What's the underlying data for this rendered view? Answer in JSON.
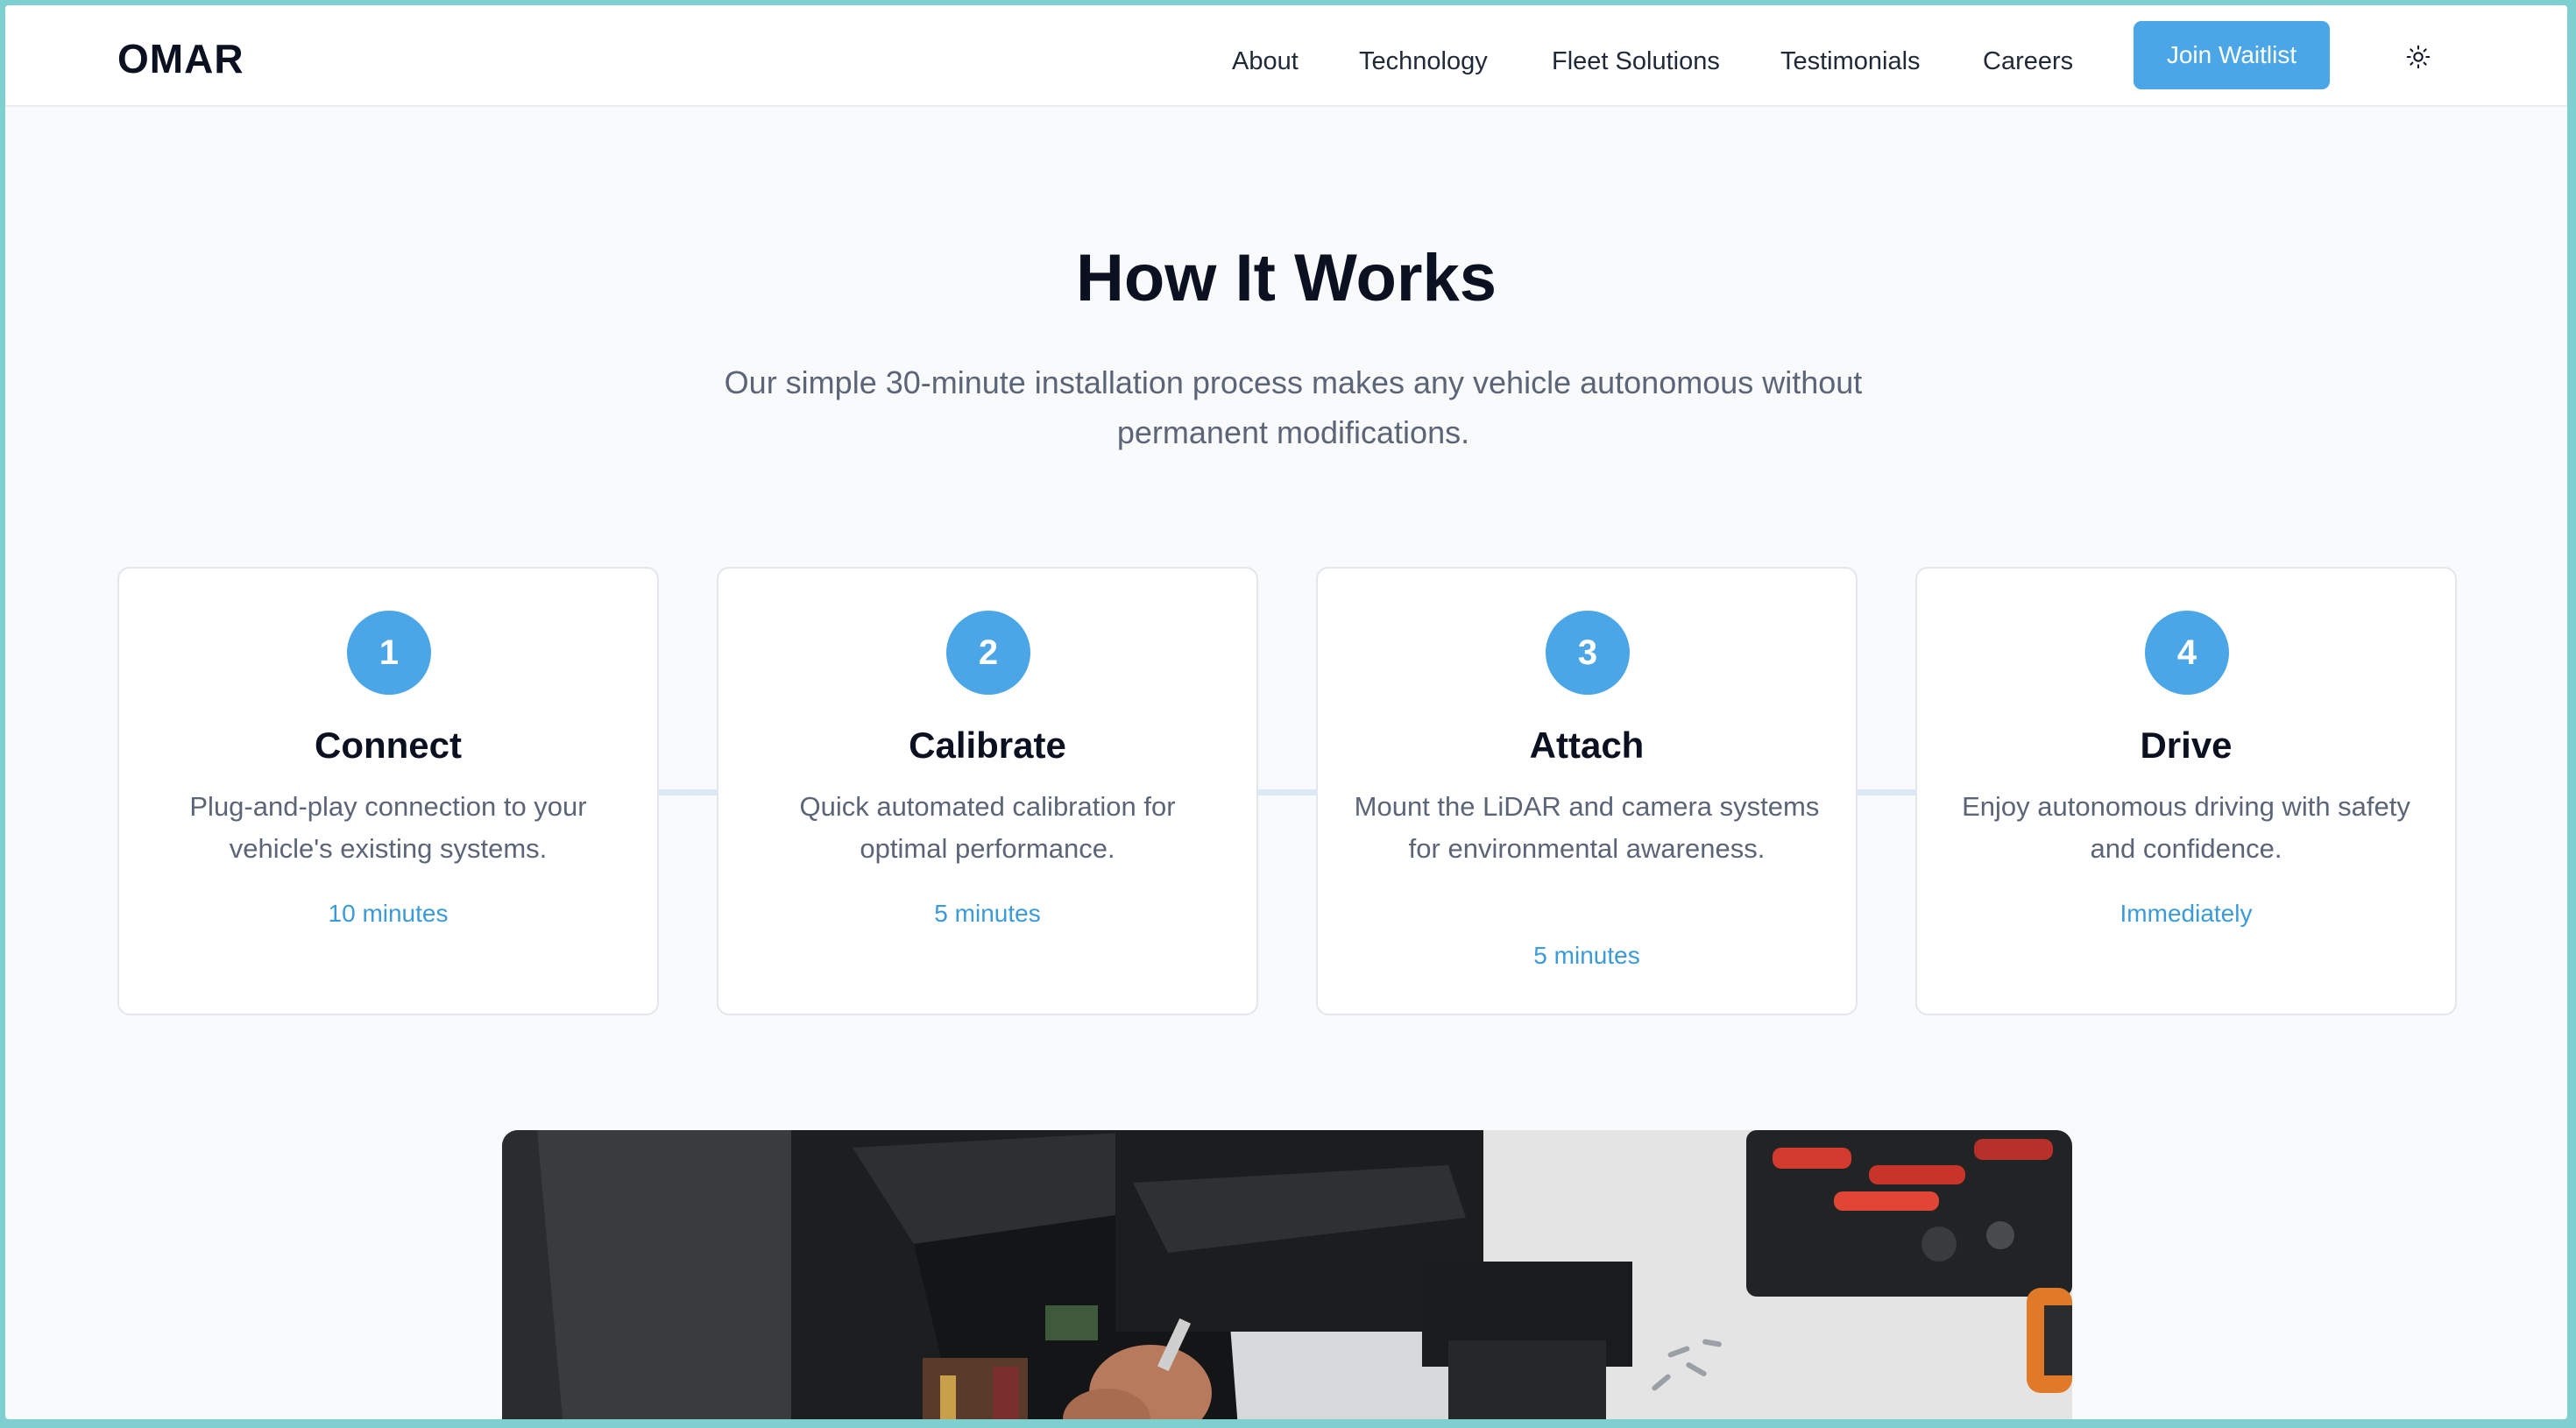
{
  "header": {
    "logo": "OMAR",
    "nav": [
      "About",
      "Technology",
      "Fleet Solutions",
      "Testimonials",
      "Careers"
    ],
    "cta": "Join Waitlist",
    "theme_icon": "sun-icon"
  },
  "section": {
    "title": "How It Works",
    "subtitle": "Our simple 30-minute installation process makes any vehicle autonomous without permanent modifications."
  },
  "steps": [
    {
      "number": "1",
      "title": "Connect",
      "description": "Plug-and-play connection to your vehicle's existing systems.",
      "time": "10 minutes"
    },
    {
      "number": "2",
      "title": "Calibrate",
      "description": "Quick automated calibration for optimal performance.",
      "time": "5 minutes"
    },
    {
      "number": "3",
      "title": "Attach",
      "description": "Mount the LiDAR and camera systems for environmental awareness.",
      "time": "5 minutes"
    },
    {
      "number": "4",
      "title": "Drive",
      "description": "Enjoy autonomous driving with safety and confidence.",
      "time": "Immediately"
    }
  ],
  "colors": {
    "accent": "#4aa6e6",
    "heading": "#0b1120",
    "body_text": "#5b6577",
    "background": "#f8fafc"
  },
  "image": {
    "subject": "installation-photo"
  }
}
